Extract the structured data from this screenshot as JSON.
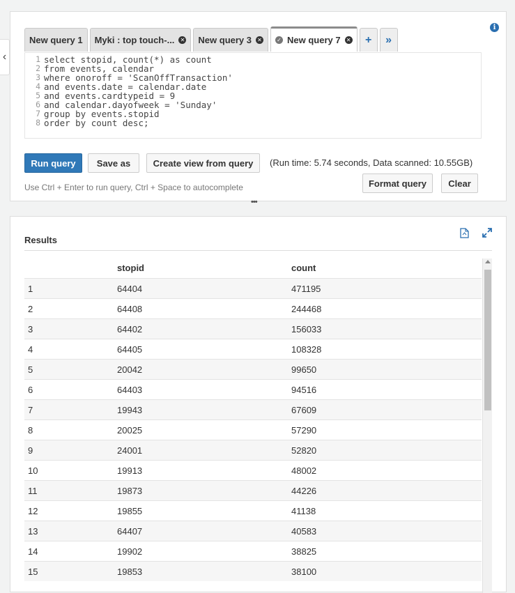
{
  "tabs": [
    {
      "label": "New query 1",
      "closable": false,
      "active": false
    },
    {
      "label": "Myki : top touch-...",
      "closable": true,
      "active": false
    },
    {
      "label": "New query 3",
      "closable": true,
      "active": false
    },
    {
      "label": "New query 7",
      "closable": true,
      "active": true
    }
  ],
  "tab_add_label": "+",
  "tab_more_label": "»",
  "editor": {
    "line_numbers": [
      "1",
      "2",
      "3",
      "4",
      "5",
      "6",
      "7",
      "8"
    ],
    "lines": [
      "select stopid, count(*) as count",
      "from events, calendar",
      "where onoroff = 'ScanOffTransaction'",
      "and events.date = calendar.date",
      "and events.cardtypeid = 9",
      "and calendar.dayofweek = 'Sunday'",
      "group by events.stopid",
      "order by count desc;"
    ]
  },
  "buttons": {
    "run": "Run query",
    "save_as": "Save as",
    "create_view": "Create view from query",
    "format": "Format query",
    "clear": "Clear"
  },
  "run_info": "(Run time: 5.74 seconds, Data scanned: 10.55GB)",
  "hint": "Use Ctrl + Enter to run query, Ctrl + Space to autocomplete",
  "results": {
    "title": "Results",
    "columns": [
      "",
      "stopid",
      "count"
    ],
    "rows": [
      [
        "1",
        "64404",
        "471195"
      ],
      [
        "2",
        "64408",
        "244468"
      ],
      [
        "3",
        "64402",
        "156033"
      ],
      [
        "4",
        "64405",
        "108328"
      ],
      [
        "5",
        "20042",
        "99650"
      ],
      [
        "6",
        "64403",
        "94516"
      ],
      [
        "7",
        "19943",
        "67609"
      ],
      [
        "8",
        "20025",
        "57290"
      ],
      [
        "9",
        "24001",
        "52820"
      ],
      [
        "10",
        "19913",
        "48002"
      ],
      [
        "11",
        "19873",
        "44226"
      ],
      [
        "12",
        "19855",
        "41138"
      ],
      [
        "13",
        "64407",
        "40583"
      ],
      [
        "14",
        "19902",
        "38825"
      ],
      [
        "15",
        "19853",
        "38100"
      ]
    ]
  },
  "colors": {
    "accent": "#3079b8",
    "icon_blue": "#2a6fb0"
  }
}
